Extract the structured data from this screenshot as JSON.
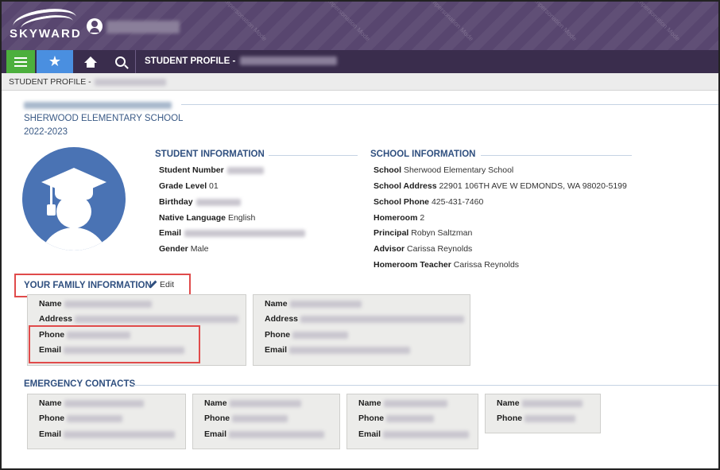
{
  "app": {
    "logo_text": "SKYWARD",
    "watermark": "Impersonation Mode"
  },
  "nav": {
    "title": "STUDENT PROFILE -"
  },
  "breadcrumb": {
    "text": "STUDENT PROFILE -"
  },
  "school": {
    "name": "SHERWOOD ELEMENTARY SCHOOL",
    "year": "2022-2023"
  },
  "student_info": {
    "heading": "STUDENT INFORMATION",
    "student_number_label": "Student Number",
    "grade_label": "Grade Level",
    "grade_value": "01",
    "birthday_label": "Birthday",
    "language_label": "Native Language",
    "language_value": "English",
    "email_label": "Email",
    "gender_label": "Gender",
    "gender_value": "Male"
  },
  "school_info": {
    "heading": "SCHOOL INFORMATION",
    "school_label": "School",
    "school_value": "Sherwood Elementary School",
    "address_label": "School Address",
    "address_value": "22901 106TH AVE W EDMONDS, WA 98020-5199",
    "phone_label": "School Phone",
    "phone_value": "425-431-7460",
    "homeroom_label": "Homeroom",
    "homeroom_value": "2",
    "principal_label": "Principal",
    "principal_value": "Robyn Saltzman",
    "advisor_label": "Advisor",
    "advisor_value": "Carissa Reynolds",
    "teacher_label": "Homeroom Teacher",
    "teacher_value": "Carissa Reynolds"
  },
  "family": {
    "heading": "YOUR FAMILY INFORMATION",
    "edit_label": "Edit",
    "name_label": "Name",
    "address_label": "Address",
    "phone_label": "Phone",
    "email_label": "Email"
  },
  "emergency": {
    "heading": "EMERGENCY CONTACTS",
    "name_label": "Name",
    "phone_label": "Phone",
    "email_label": "Email"
  },
  "colors": {
    "banner": "#58466f",
    "navbar": "#3a2d4d",
    "menu_green": "#4caf3d",
    "star_blue": "#4a8fe0",
    "heading_blue": "#2f4f7f",
    "highlight_red": "#e04b4b"
  },
  "icons": {
    "menu": "hamburger-icon",
    "favorites": "star-icon",
    "home": "home-icon",
    "search": "search-icon",
    "edit": "pencil-icon",
    "avatar": "graduate-avatar-icon"
  }
}
